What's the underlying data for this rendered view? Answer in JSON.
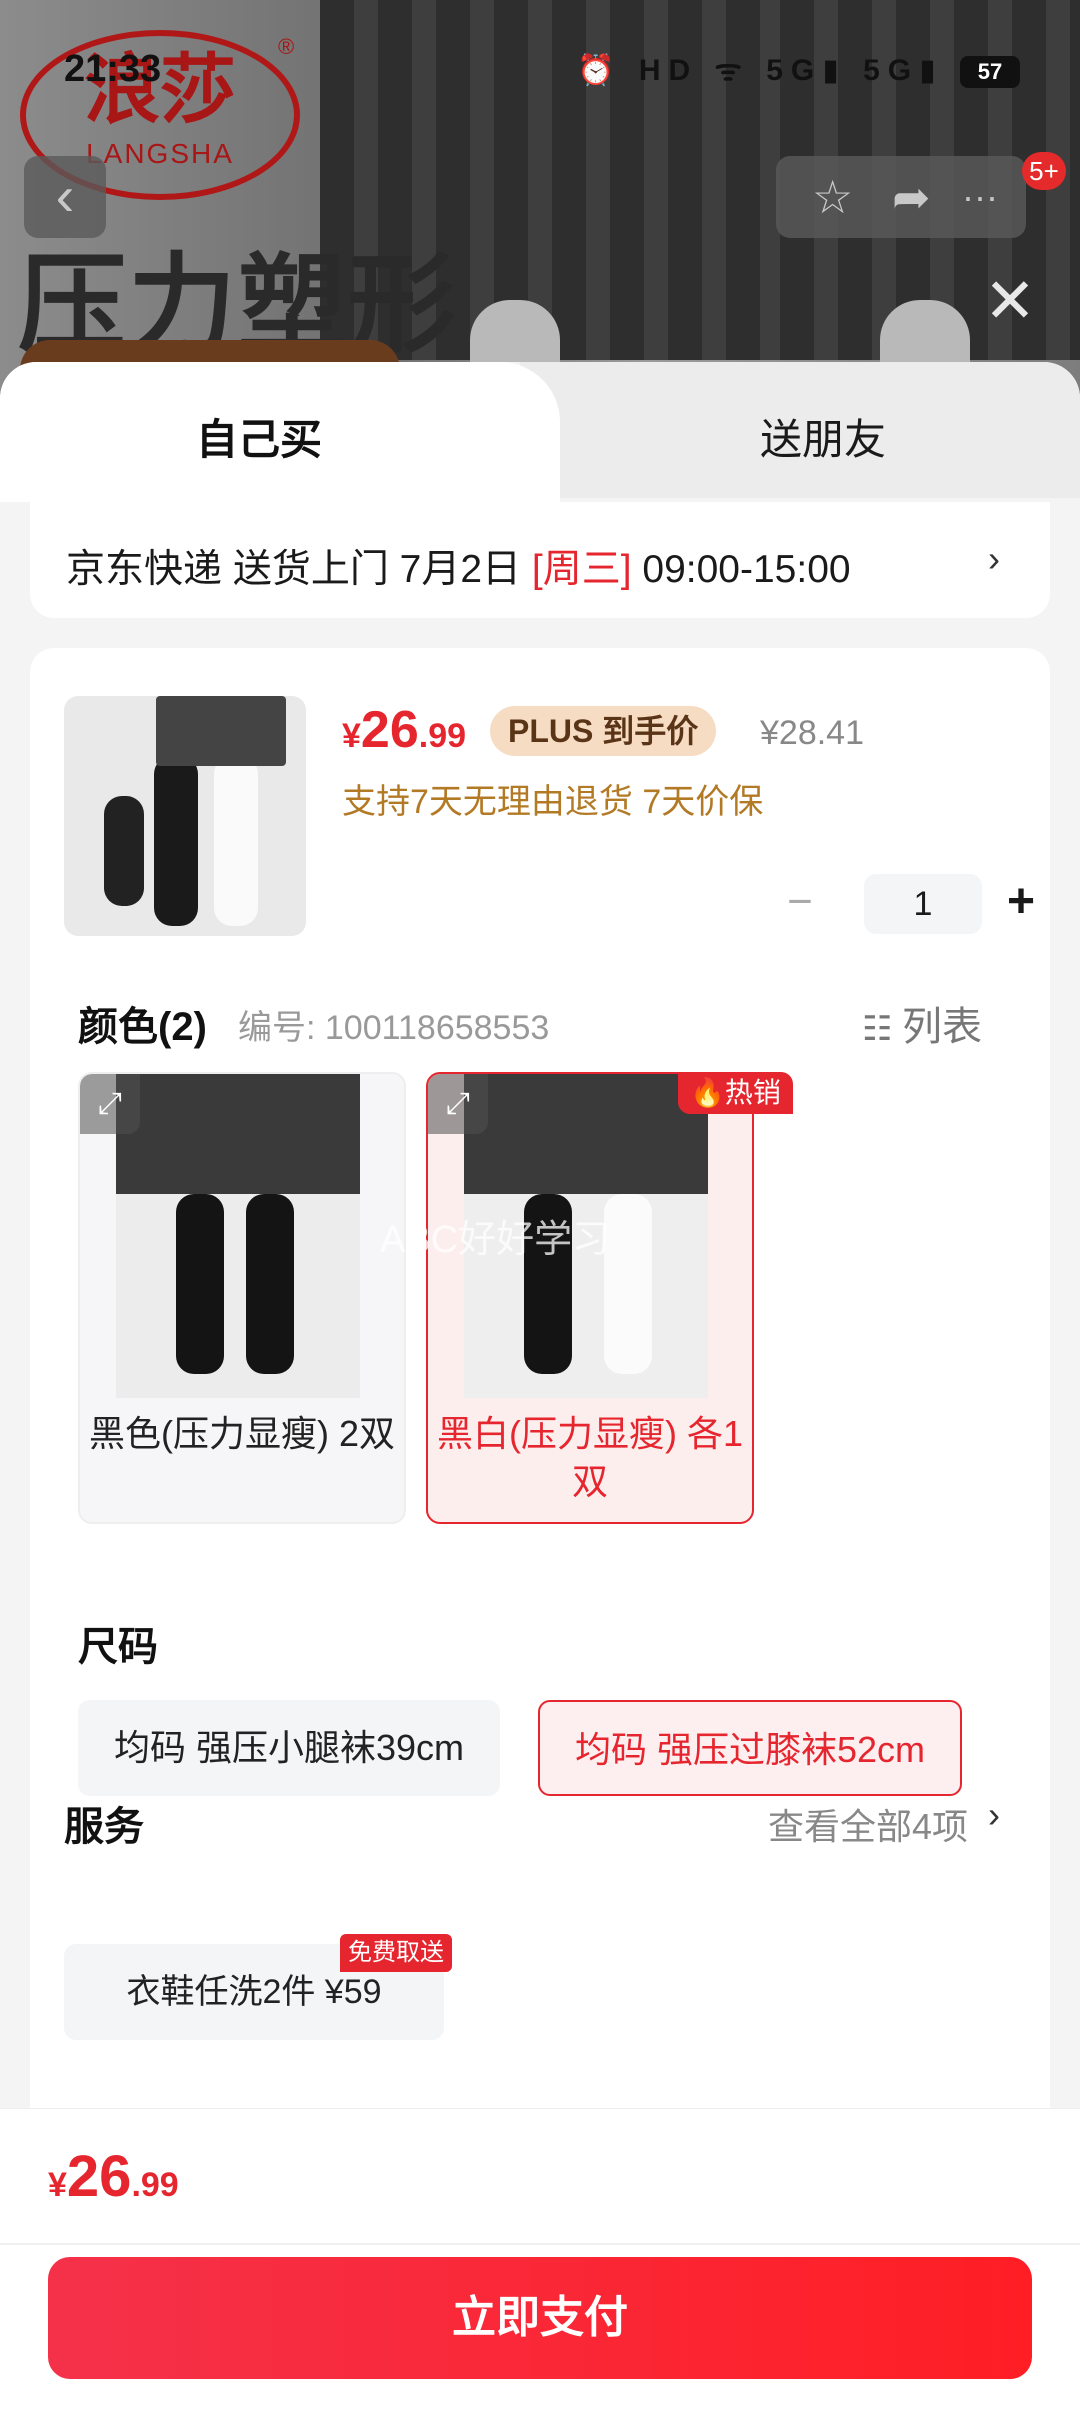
{
  "status_bar": {
    "time": "21:33",
    "icons_text": "⏰ HD ᯤ 5G▮ 5G▮",
    "battery": "57"
  },
  "background": {
    "logo_cn": "浪莎",
    "logo_en": "LANGSHA",
    "logo_reg": "®",
    "headline": "压力塑形"
  },
  "nav": {
    "back_icon": "‹",
    "favorite_icon": "☆",
    "share_icon": "➦",
    "more_icon": "···",
    "badge": "5+",
    "close_icon": "✕"
  },
  "tabs": {
    "buy_self": "自己买",
    "gift": "送朋友"
  },
  "delivery": {
    "prefix": "京东快递 送货上门 7月2日 ",
    "weekday": "[周三]",
    "window": " 09:00-15:00",
    "chevron": "›"
  },
  "product": {
    "currency": "¥",
    "price_int": "26",
    "price_dec": ".99",
    "plus_tag": "PLUS 到手价",
    "original_price": "¥28.41",
    "guarantee": "支持7天无理由退货  7天价保",
    "quantity": "1",
    "minus": "−",
    "plus": "+"
  },
  "color_section": {
    "title": "颜色(2)",
    "sku_no": "编号: 100118658553",
    "list_icon": "☷",
    "list_label": "列表",
    "hot_badge": "🔥热销",
    "watermark": "ABC好好学习",
    "zoom_icon": "⤢",
    "options": [
      {
        "label": "黑色(压力显瘦) 2双"
      },
      {
        "label": "黑白(压力显瘦) 各1双"
      }
    ]
  },
  "size_section": {
    "title": "尺码",
    "options": [
      {
        "label": "均码 强压小腿袜39cm"
      },
      {
        "label": "均码 强压过膝袜52cm"
      }
    ]
  },
  "service_section": {
    "title": "服务",
    "view_all": "查看全部4项",
    "chevron": "›",
    "free_tag": "免费取送",
    "option": "衣鞋任洗2件  ¥59"
  },
  "bottom": {
    "currency": "¥",
    "total_int": "26",
    "total_dec": ".99",
    "pay_button": "立即支付"
  },
  "colors": {
    "accent_red": "#e6262f",
    "gold_text": "#b37a26",
    "plus_bg": "#f7dcc4"
  }
}
